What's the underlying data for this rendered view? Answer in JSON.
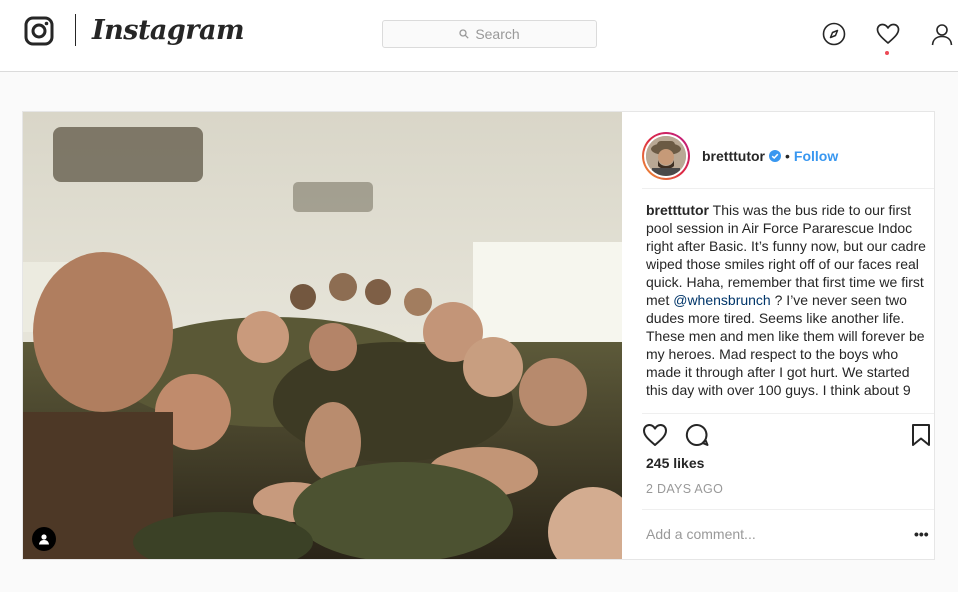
{
  "nav": {
    "brand": "Instagram",
    "search_placeholder": "Search",
    "icons": [
      "instagram-logo-icon",
      "search-icon",
      "explore-compass-icon",
      "activity-heart-icon",
      "profile-icon"
    ],
    "notification_color": "#ed4956"
  },
  "post": {
    "username": "bretttutor",
    "verified": true,
    "separator": "•",
    "follow_label": "Follow",
    "caption_parts": [
      {
        "type": "user",
        "text": "bretttutor"
      },
      {
        "type": "text",
        "text": " This was the bus ride to our first pool session in Air Force Pararescue Indoc right after Basic. It’s funny now, but our cadre wiped those smiles right off of our faces real quick. Haha, remember that first time we first met "
      },
      {
        "type": "mention",
        "text": "@whensbrunch"
      },
      {
        "type": "text",
        "text": " ? I’ve never seen two dudes more tired. Seems like another life."
      },
      {
        "type": "text2",
        "text": "These men and men like them will forever be my heroes. Mad respect to the boys who made it through after I got hurt. We started this day with over 100 guys. I think about 9"
      }
    ],
    "likes": "245 likes",
    "time_ago": "2 DAYS AGO",
    "comment_placeholder": "Add a comment...",
    "more_label": "•••",
    "colors": {
      "accent": "#3897f0",
      "mention": "#003569",
      "muted": "#999999"
    }
  }
}
